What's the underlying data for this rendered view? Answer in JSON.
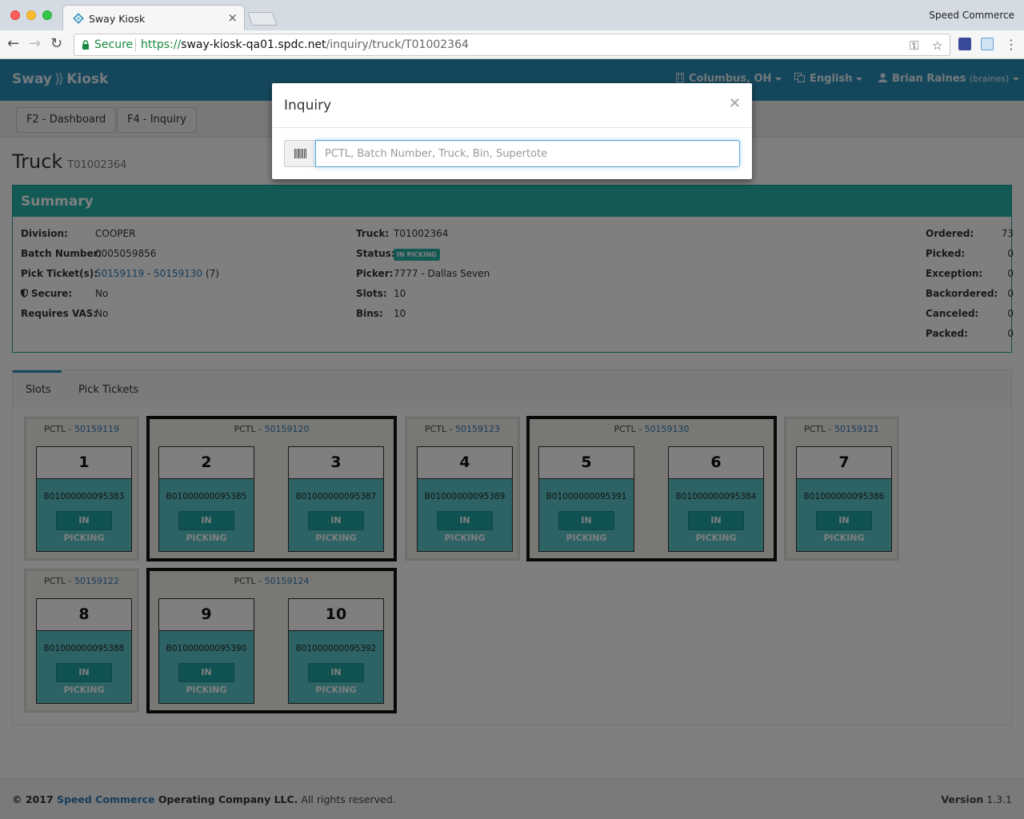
{
  "browser": {
    "tab_title": "Sway Kiosk",
    "tab_close": "×",
    "profile": "Speed Commerce",
    "secure_label": "Secure",
    "url_scheme": "https://",
    "url_host": "sway-kiosk-qa01.spdc.net",
    "url_path": "/inquiry/truck/T01002364",
    "back": "←",
    "forward": "→",
    "reload": "↻",
    "key_icon": "⚿",
    "star_icon": "☆",
    "menu_icon": "⋮"
  },
  "navbar": {
    "brand_left": "Sway",
    "brand_arrow": "⟫",
    "brand_right": "Kiosk",
    "location": "Columbus, OH",
    "language": "English",
    "user": "Brian Raines",
    "username": "(braines)"
  },
  "subnav": {
    "dashboard": "F2 - Dashboard",
    "inquiry": "F4 - Inquiry"
  },
  "page": {
    "title": "Truck",
    "truck_id": "T01002364"
  },
  "summary": {
    "heading": "Summary",
    "left": [
      {
        "label": "Division:",
        "value": "COOPER"
      },
      {
        "label": "Batch Number:",
        "value": "0005059856"
      },
      {
        "label": "Pick Ticket(s):",
        "value_a": "50159119",
        "sep": " - ",
        "value_b": "50159130",
        "extra": " (7)"
      },
      {
        "label": "Secure:",
        "value": "No"
      },
      {
        "label": "Requires VAS:",
        "value": "No"
      }
    ],
    "middle": [
      {
        "label": "Truck:",
        "value": "T01002364"
      },
      {
        "label": "Status:",
        "value": "IN PICKING"
      },
      {
        "label": "Picker:",
        "value": "7777 - Dallas Seven"
      },
      {
        "label": "Slots:",
        "value": "10"
      },
      {
        "label": "Bins:",
        "value": "10"
      }
    ],
    "right": [
      {
        "label": "Ordered:",
        "value": "73"
      },
      {
        "label": "Picked:",
        "value": "0"
      },
      {
        "label": "Exception:",
        "value": "0"
      },
      {
        "label": "Backordered:",
        "value": "0"
      },
      {
        "label": "Canceled:",
        "value": "0"
      },
      {
        "label": "Packed:",
        "value": "0"
      }
    ]
  },
  "tabs": {
    "slots": "Slots",
    "pick_tickets": "Pick Tickets"
  },
  "groups": [
    {
      "pctl_label": "PCTL - ",
      "pctl": "50159119",
      "slots": [
        {
          "num": "1",
          "bin": "B01000000095383",
          "status": "IN PICKING"
        }
      ]
    },
    {
      "pctl_label": "PCTL - ",
      "pctl": "50159120",
      "slots": [
        {
          "num": "2",
          "bin": "B01000000095385",
          "status": "IN PICKING"
        },
        {
          "num": "3",
          "bin": "B01000000095387",
          "status": "IN PICKING"
        }
      ]
    },
    {
      "pctl_label": "PCTL - ",
      "pctl": "50159123",
      "slots": [
        {
          "num": "4",
          "bin": "B01000000095389",
          "status": "IN PICKING"
        }
      ]
    },
    {
      "pctl_label": "PCTL - ",
      "pctl": "50159130",
      "slots": [
        {
          "num": "5",
          "bin": "B01000000095391",
          "status": "IN PICKING"
        },
        {
          "num": "6",
          "bin": "B01000000095384",
          "status": "IN PICKING"
        }
      ]
    },
    {
      "pctl_label": "PCTL - ",
      "pctl": "50159121",
      "slots": [
        {
          "num": "7",
          "bin": "B01000000095386",
          "status": "IN PICKING"
        }
      ]
    },
    {
      "pctl_label": "PCTL - ",
      "pctl": "50159122",
      "slots": [
        {
          "num": "8",
          "bin": "B01000000095388",
          "status": "IN PICKING"
        }
      ]
    },
    {
      "pctl_label": "PCTL - ",
      "pctl": "50159124",
      "slots": [
        {
          "num": "9",
          "bin": "B01000000095390",
          "status": "IN PICKING"
        },
        {
          "num": "10",
          "bin": "B01000000095392",
          "status": "IN PICKING"
        }
      ]
    }
  ],
  "footer": {
    "copyright": "© 2017 ",
    "company_link": "Speed Commerce",
    "company_rest": " Operating Company LLC.",
    "rights": " All rights reserved.",
    "version_label": "Version",
    "version": " 1.3.1"
  },
  "modal": {
    "title": "Inquiry",
    "close": "×",
    "placeholder": "PCTL, Batch Number, Truck, Bin, Supertote"
  },
  "colors": {
    "navbar": "#2b8fb8",
    "summary_heading": "#26b5aa",
    "slot_body": "#5cc7cc",
    "status_badge": "#1fa5a2",
    "link": "#2a7bb8",
    "secure_green": "#168a3e"
  }
}
